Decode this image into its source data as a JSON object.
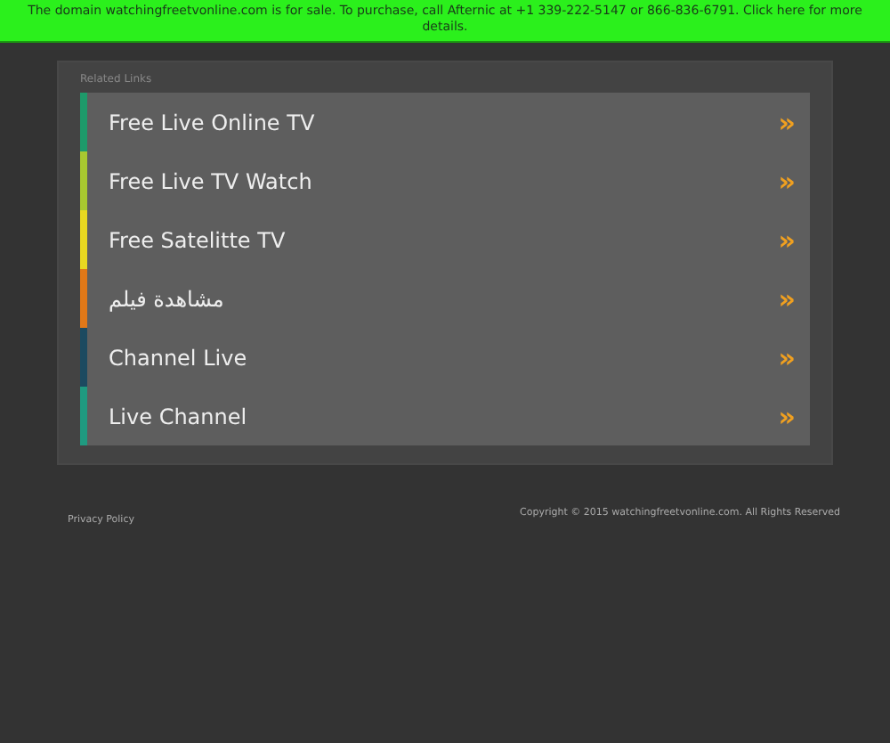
{
  "banner": {
    "text": "The domain watchingfreetvonline.com is for sale. To purchase, call Afternic at +1 339-222-5147 or 866-836-6791. Click here for more details."
  },
  "related": {
    "heading": "Related Links",
    "links": [
      {
        "label": "Free Live Online TV",
        "color": "#1e9a6a",
        "arrow": "»"
      },
      {
        "label": "Free Live TV Watch",
        "color": "#a8c830",
        "arrow": "»"
      },
      {
        "label": "Free Satelitte TV",
        "color": "#e8d820",
        "arrow": "»"
      },
      {
        "label": "مشاهدة فيلم",
        "color": "#e07818",
        "arrow": "»"
      },
      {
        "label": "Channel Live",
        "color": "#1c4a60",
        "arrow": "»"
      },
      {
        "label": "Live Channel",
        "color": "#1f9a80",
        "arrow": "»"
      }
    ]
  },
  "footer": {
    "privacy": "Privacy Policy",
    "copyright": "Copyright © 2015 watchingfreetvonline.com. All Rights Reserved"
  }
}
